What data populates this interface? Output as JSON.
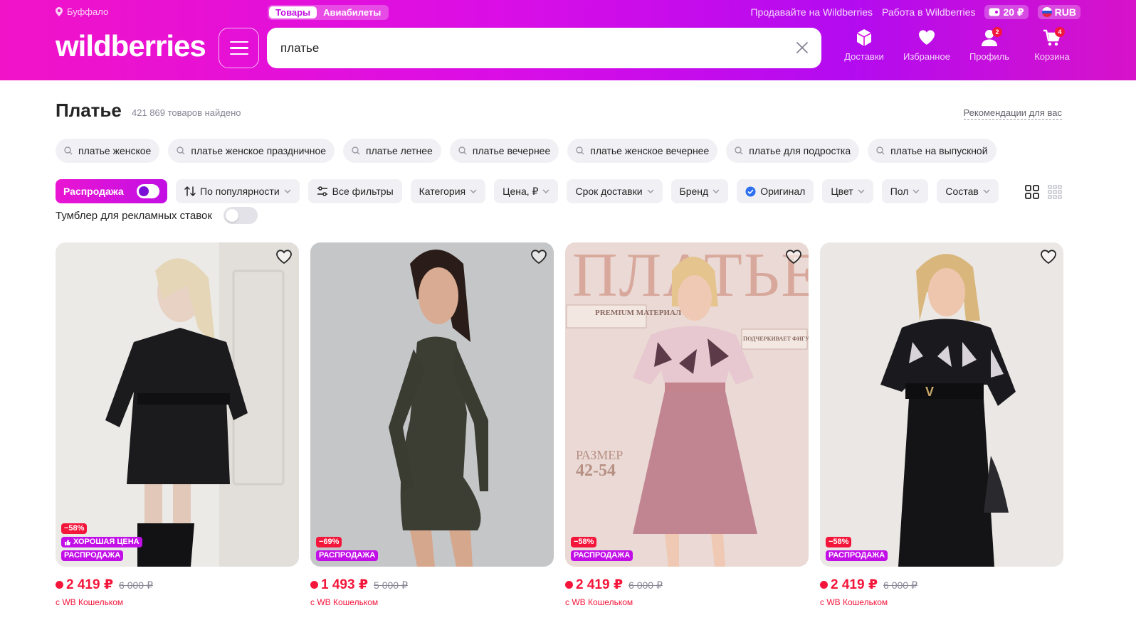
{
  "header": {
    "location": "Буффало",
    "tabs": [
      {
        "label": "Товары"
      },
      {
        "label": "Авиабилеты"
      }
    ],
    "links": [
      "Продавайте на Wildberries",
      "Работа в Wildberries"
    ],
    "balance": "20 ₽",
    "currency": "RUB",
    "logo": "wildberries",
    "search": {
      "value": "платье",
      "placeholder": ""
    },
    "nav": [
      {
        "label": "Доставки",
        "badge": ""
      },
      {
        "label": "Избранное",
        "badge": ""
      },
      {
        "label": "Профиль",
        "badge": "2"
      },
      {
        "label": "Корзина",
        "badge": "4"
      }
    ]
  },
  "colors": {
    "brand": "#cb11ab",
    "accent_red": "#f4163a"
  },
  "page": {
    "title": "Платье",
    "found": "421 869 товаров найдено",
    "recommendations": "Рекомендации для вас"
  },
  "suggestions": [
    "платье женское",
    "платье женское праздничное",
    "платье летнее",
    "платье вечернее",
    "платье женское вечернее",
    "платье для подростка",
    "платье на выпускной"
  ],
  "filters": {
    "sale": "Распродажа",
    "sort": "По популярности",
    "all": "Все фильтры",
    "items": [
      "Категория",
      "Цена, ₽",
      "Срок доставки",
      "Бренд"
    ],
    "original": "Оригинал",
    "items2": [
      "Цвет",
      "Пол",
      "Состав"
    ]
  },
  "ad_toggle": "Тумблер для рекламных ставок",
  "products": [
    {
      "discount": "−58%",
      "good_price": "ХОРОШАЯ ЦЕНА",
      "sale": "РАСПРОДАЖА",
      "price": "2 419 ₽",
      "old": "6 000 ₽",
      "wallet": "с WB Кошельком"
    },
    {
      "discount": "−69%",
      "good_price": "",
      "sale": "РАСПРОДАЖА",
      "price": "1 493 ₽",
      "old": "5 000 ₽",
      "wallet": "с WB Кошельком"
    },
    {
      "discount": "−58%",
      "good_price": "",
      "sale": "РАСПРОДАЖА",
      "price": "2 419 ₽",
      "old": "6 000 ₽",
      "wallet": "с WB Кошельком",
      "overlay": {
        "title": "ПЛАТЬЕ",
        "premium": "PREMIUM МАТЕРИАЛ",
        "shape": "ПОДЧЕРКИВАЕТ ФИГУРУ",
        "size_label": "РАЗМЕР",
        "size": "42-54"
      }
    },
    {
      "discount": "−58%",
      "good_price": "",
      "sale": "РАСПРОДАЖА",
      "price": "2 419 ₽",
      "old": "6 000 ₽",
      "wallet": "с WB Кошельком"
    }
  ]
}
